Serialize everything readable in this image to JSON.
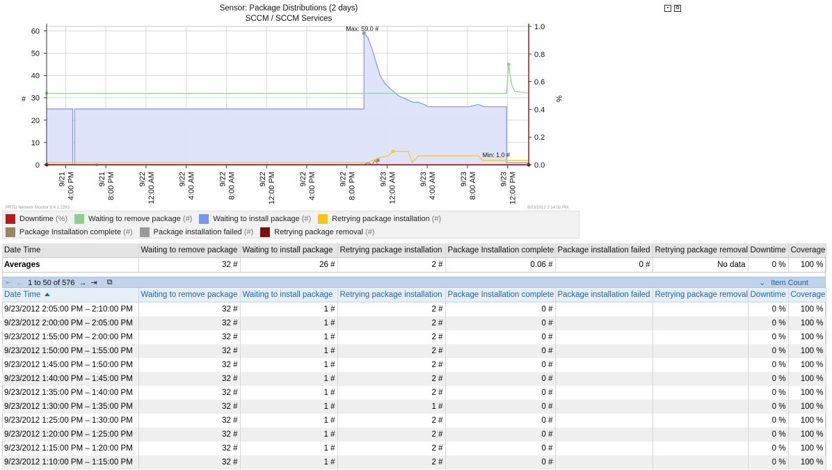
{
  "chart": {
    "title_line1": "Sensor: Package Distributions (2 days)",
    "title_line2": "SCCM / SCCM Services",
    "max_label": "Max: 59.0 #",
    "min_label": "Min: 1.0 #",
    "left_axis_label": "#",
    "right_axis_label": "%",
    "left_ticks": [
      "0",
      "10",
      "20",
      "30",
      "40",
      "50",
      "60"
    ],
    "right_ticks": [
      "0.0",
      "0.2",
      "0.4",
      "0.6",
      "0.8",
      "1.0"
    ],
    "x_ticks": [
      [
        "9/21",
        "4:00 PM"
      ],
      [
        "9/21",
        "8:00 PM"
      ],
      [
        "9/22",
        "12:00 AM"
      ],
      [
        "9/22",
        "4:00 AM"
      ],
      [
        "9/22",
        "8:00 AM"
      ],
      [
        "9/22",
        "12:00 PM"
      ],
      [
        "9/22",
        "4:00 PM"
      ],
      [
        "9/22",
        "8:00 PM"
      ],
      [
        "9/23",
        "12:00 AM"
      ],
      [
        "9/23",
        "4:00 AM"
      ],
      [
        "9/23",
        "8:00 AM"
      ],
      [
        "9/23",
        "12:00 PM"
      ]
    ],
    "version": "PRTG Network Monitor 8.4.1.2283",
    "timestamp": "9/23/2012 2:14:02 PM",
    "colors": {
      "downtime": "#b31c1c",
      "waiting_remove": "#8fd08f",
      "waiting_install": "#7b96e8",
      "waiting_install_fill": "#dde3fa",
      "retrying_install": "#f5c518",
      "install_complete": "#9a8468",
      "install_failed": "#9a9a9a",
      "retrying_removal": "#7a0f0f",
      "axis_right": "#9b1c1c"
    }
  },
  "chart_data": {
    "type": "line",
    "title": "Sensor: Package Distributions (2 days)",
    "subtitle": "SCCM / SCCM Services",
    "ylabel": "#",
    "y2label": "%",
    "ylim": [
      0,
      62
    ],
    "y2lim": [
      0,
      1.0
    ],
    "x_range_hours": [
      0,
      48
    ],
    "x_tick_labels": [
      "9/21 4:00 PM",
      "9/21 8:00 PM",
      "9/22 12:00 AM",
      "9/22 4:00 AM",
      "9/22 8:00 AM",
      "9/22 12:00 PM",
      "9/22 4:00 PM",
      "9/22 8:00 PM",
      "9/23 12:00 AM",
      "9/23 4:00 AM",
      "9/23 8:00 AM",
      "9/23 12:00 PM"
    ],
    "x_tick_hours": [
      1.9,
      5.9,
      9.9,
      13.9,
      17.9,
      21.9,
      25.9,
      29.9,
      33.9,
      37.9,
      41.9,
      45.9
    ],
    "grid": true,
    "series": [
      {
        "name": "Waiting to install package",
        "key": "waiting_install",
        "fill": true,
        "points": [
          [
            0,
            25
          ],
          [
            2.6,
            25
          ],
          [
            2.6,
            0
          ],
          [
            2.8,
            0
          ],
          [
            2.8,
            25
          ],
          [
            31.6,
            25
          ],
          [
            31.6,
            59
          ],
          [
            32.0,
            57
          ],
          [
            32.4,
            52
          ],
          [
            32.8,
            46
          ],
          [
            33.2,
            40
          ],
          [
            33.6,
            37
          ],
          [
            34.0,
            35
          ],
          [
            34.5,
            33
          ],
          [
            35.0,
            31
          ],
          [
            35.5,
            30
          ],
          [
            36.0,
            29
          ],
          [
            36.5,
            28
          ],
          [
            37.0,
            28
          ],
          [
            37.6,
            27
          ],
          [
            38.0,
            26
          ],
          [
            39.0,
            26
          ],
          [
            40.0,
            26
          ],
          [
            41.0,
            26
          ],
          [
            42.0,
            26
          ],
          [
            43.0,
            27
          ],
          [
            43.6,
            26
          ],
          [
            45.8,
            26
          ],
          [
            45.8,
            1
          ],
          [
            48,
            1
          ]
        ]
      },
      {
        "name": "Waiting to remove package",
        "key": "waiting_remove",
        "points": [
          [
            0,
            32
          ],
          [
            2.6,
            32
          ],
          [
            2.8,
            32
          ],
          [
            45.8,
            32
          ],
          [
            46.0,
            45
          ],
          [
            46.3,
            36
          ],
          [
            46.6,
            33
          ],
          [
            48,
            32
          ]
        ]
      },
      {
        "name": "Retrying package installation",
        "key": "retrying_install",
        "points": [
          [
            0,
            1
          ],
          [
            31.6,
            1
          ],
          [
            32.0,
            1
          ],
          [
            33.0,
            3
          ],
          [
            34.0,
            4
          ],
          [
            34.5,
            6
          ],
          [
            36.0,
            6
          ],
          [
            36.4,
            1
          ],
          [
            37.0,
            4
          ],
          [
            38.0,
            4
          ],
          [
            39.0,
            4
          ],
          [
            42.0,
            4
          ],
          [
            43.0,
            4
          ],
          [
            43.4,
            2
          ],
          [
            48,
            2
          ]
        ]
      },
      {
        "name": "Package Installation complete",
        "key": "install_complete",
        "points": [
          [
            0,
            0
          ],
          [
            31.6,
            0
          ],
          [
            32.0,
            1
          ],
          [
            32.4,
            0
          ],
          [
            32.7,
            2
          ],
          [
            33.0,
            0
          ],
          [
            48,
            0
          ]
        ]
      },
      {
        "name": "Package installation failed",
        "key": "install_failed",
        "points": [
          [
            0,
            0
          ],
          [
            48,
            0
          ]
        ]
      },
      {
        "name": "Retrying package removal",
        "key": "retrying_removal",
        "points": [
          [
            0,
            0
          ],
          [
            48,
            0
          ]
        ]
      },
      {
        "name": "Downtime",
        "key": "downtime",
        "axis": "right",
        "points": [
          [
            0,
            0
          ],
          [
            48,
            0
          ]
        ]
      }
    ]
  },
  "legend": {
    "row1": [
      {
        "key": "downtime",
        "label": "Downtime",
        "unit": "(%)"
      },
      {
        "key": "waiting_remove",
        "label": "Waiting to remove package",
        "unit": "(#)"
      },
      {
        "key": "waiting_install",
        "label": "Waiting to install package",
        "unit": "(#)"
      },
      {
        "key": "retrying_install",
        "label": "Retrying package installation",
        "unit": "(#)"
      }
    ],
    "row2": [
      {
        "key": "install_complete",
        "label": "Package Installation complete",
        "unit": "(#)"
      },
      {
        "key": "install_failed",
        "label": "Package installation failed",
        "unit": "(#)"
      },
      {
        "key": "retrying_removal",
        "label": "Retrying package removal",
        "unit": "(#)"
      }
    ]
  },
  "columns": [
    "Date Time",
    "Waiting to remove package",
    "Waiting to install package",
    "Retrying package installation",
    "Package Installation complete",
    "Package installation failed",
    "Retrying package removal",
    "Downtime",
    "Coverage"
  ],
  "averages": {
    "label": "Averages",
    "values": [
      "32 #",
      "26 #",
      "2 #",
      "0.06 #",
      "0 #",
      "No data",
      "0 %",
      "100 %"
    ]
  },
  "pager": {
    "range_text": "1 to 50 of 576",
    "item_count_label": "Item Count"
  },
  "rows": [
    [
      "9/23/2012 2:05:00 PM – 2:10:00 PM",
      "32 #",
      "1 #",
      "2 #",
      "0 #",
      "",
      "",
      "0 %",
      "100 %"
    ],
    [
      "9/23/2012 2:00:00 PM – 2:05:00 PM",
      "32 #",
      "1 #",
      "2 #",
      "0 #",
      "",
      "",
      "0 %",
      "100 %"
    ],
    [
      "9/23/2012 1:55:00 PM – 2:00:00 PM",
      "32 #",
      "1 #",
      "2 #",
      "0 #",
      "",
      "",
      "0 %",
      "100 %"
    ],
    [
      "9/23/2012 1:50:00 PM – 1:55:00 PM",
      "32 #",
      "1 #",
      "2 #",
      "0 #",
      "",
      "",
      "0 %",
      "100 %"
    ],
    [
      "9/23/2012 1:45:00 PM – 1:50:00 PM",
      "32 #",
      "1 #",
      "2 #",
      "0 #",
      "",
      "",
      "0 %",
      "100 %"
    ],
    [
      "9/23/2012 1:40:00 PM – 1:45:00 PM",
      "32 #",
      "1 #",
      "2 #",
      "0 #",
      "",
      "",
      "0 %",
      "100 %"
    ],
    [
      "9/23/2012 1:35:00 PM – 1:40:00 PM",
      "32 #",
      "1 #",
      "2 #",
      "0 #",
      "",
      "",
      "0 %",
      "100 %"
    ],
    [
      "9/23/2012 1:30:00 PM – 1:35:00 PM",
      "32 #",
      "1 #",
      "1 #",
      "0 #",
      "",
      "",
      "0 %",
      "100 %"
    ],
    [
      "9/23/2012 1:25:00 PM – 1:30:00 PM",
      "32 #",
      "1 #",
      "2 #",
      "0 #",
      "",
      "",
      "0 %",
      "100 %"
    ],
    [
      "9/23/2012 1:20:00 PM – 1:25:00 PM",
      "32 #",
      "1 #",
      "2 #",
      "0 #",
      "",
      "",
      "0 %",
      "100 %"
    ],
    [
      "9/23/2012 1:15:00 PM – 1:20:00 PM",
      "32 #",
      "1 #",
      "2 #",
      "0 #",
      "",
      "",
      "0 %",
      "100 %"
    ],
    [
      "9/23/2012 1:10:00 PM – 1:15:00 PM",
      "32 #",
      "1 #",
      "2 #",
      "0 #",
      "",
      "",
      "0 %",
      "100 %"
    ]
  ]
}
